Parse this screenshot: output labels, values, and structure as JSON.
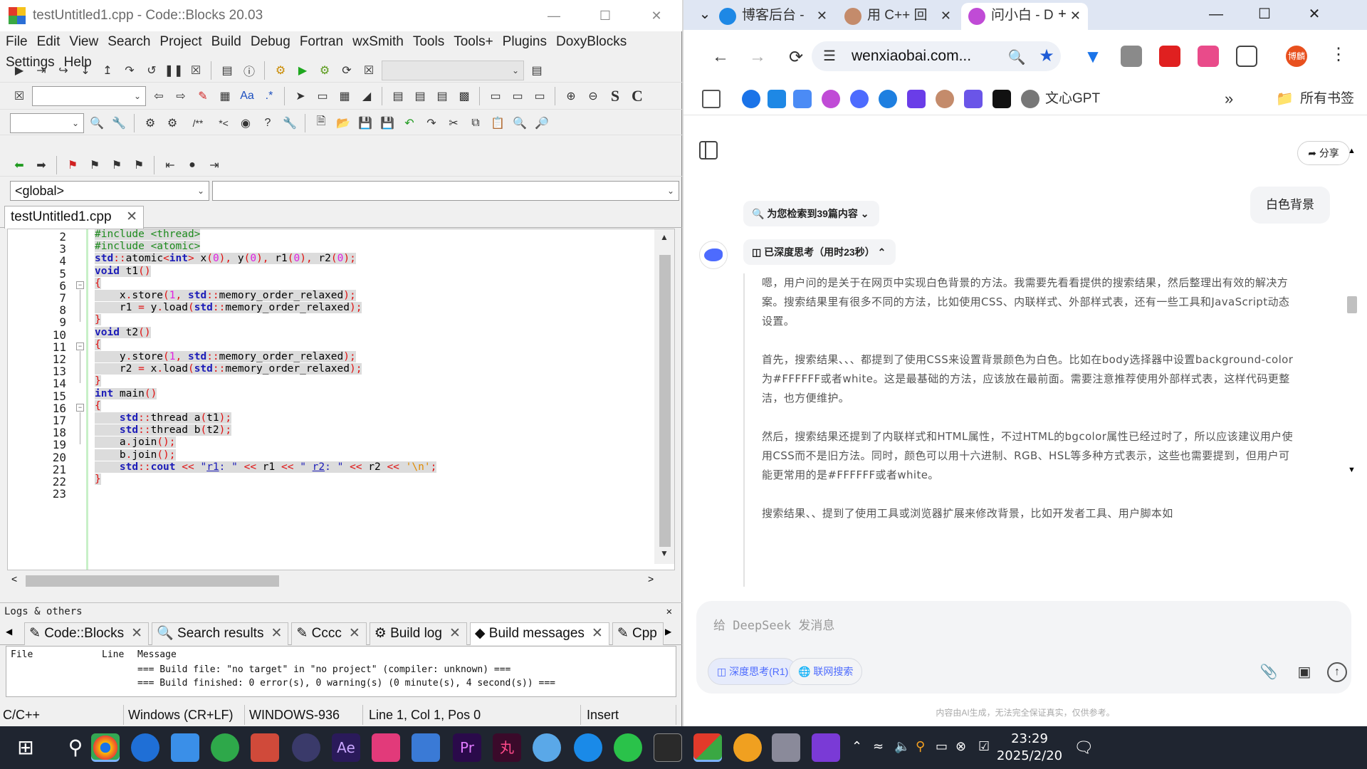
{
  "codeblocks": {
    "title": "testUntitled1.cpp - Code::Blocks 20.03",
    "menu": [
      "File",
      "Edit",
      "View",
      "Search",
      "Project",
      "Build",
      "Debug",
      "Fortran",
      "wxSmith",
      "Tools",
      "Tools+",
      "Plugins",
      "DoxyBlocks",
      "Settings",
      "Help"
    ],
    "scope_combo": "<global>",
    "editor_tab": "testUntitled1.cpp",
    "code_lines": [
      {
        "n": "2",
        "html": "<span class='sel'><span class='pp'>#include &lt;thread&gt;</span></span>"
      },
      {
        "n": "3",
        "html": "<span class='sel'><span class='pp'>#include &lt;atomic&gt;</span></span>"
      },
      {
        "n": "4",
        "html": "<span class='sel'><span class='ns'>std</span><span class='op'>::</span>atomic<span class='op'>&lt;</span><span class='k'>int</span><span class='op'>&gt;</span> x<span class='op'>(</span><span class='num'>0</span><span class='op'>),</span> y<span class='op'>(</span><span class='num'>0</span><span class='op'>),</span> r1<span class='op'>(</span><span class='num'>0</span><span class='op'>),</span> r2<span class='op'>(</span><span class='num'>0</span><span class='op'>);</span></span>"
      },
      {
        "n": "5",
        "html": "<span class='sel'><span class='k'>void</span> t1<span class='op'>()</span></span>"
      },
      {
        "n": "6",
        "html": "<span class='sel'><span class='op'>{</span></span>"
      },
      {
        "n": "7",
        "html": "<span class='sel'>    x<span class='op'>.</span>store<span class='op'>(</span><span class='num'>1</span><span class='op'>,</span> <span class='ns'>std</span><span class='op'>::</span>memory_order_relaxed<span class='op'>);</span></span>"
      },
      {
        "n": "8",
        "html": "<span class='sel'>    r1 <span class='op'>=</span> y<span class='op'>.</span>load<span class='op'>(</span><span class='ns'>std</span><span class='op'>::</span>memory_order_relaxed<span class='op'>);</span></span>"
      },
      {
        "n": "9",
        "html": "<span class='sel'><span class='op'>}</span></span>"
      },
      {
        "n": "10",
        "html": "<span class='sel'><span class='k'>void</span> t2<span class='op'>()</span></span>"
      },
      {
        "n": "11",
        "html": "<span class='sel'><span class='op'>{</span></span>"
      },
      {
        "n": "12",
        "html": "<span class='sel'>    y<span class='op'>.</span>store<span class='op'>(</span><span class='num'>1</span><span class='op'>,</span> <span class='ns'>std</span><span class='op'>::</span>memory_order_relaxed<span class='op'>);</span></span>"
      },
      {
        "n": "13",
        "html": "<span class='sel'>    r2 <span class='op'>=</span> x<span class='op'>.</span>load<span class='op'>(</span><span class='ns'>std</span><span class='op'>::</span>memory_order_relaxed<span class='op'>);</span></span>"
      },
      {
        "n": "14",
        "html": "<span class='sel'><span class='op'>}</span></span>"
      },
      {
        "n": "15",
        "html": "<span class='sel'><span class='k'>int</span> main<span class='op'>()</span></span>"
      },
      {
        "n": "16",
        "html": "<span class='sel'><span class='op'>{</span></span>"
      },
      {
        "n": "17",
        "html": "<span class='sel'>    <span class='ns'>std</span><span class='op'>::</span>thread a<span class='op'>(</span>t1<span class='op'>);</span></span>"
      },
      {
        "n": "18",
        "html": "<span class='sel'>    <span class='ns'>std</span><span class='op'>::</span>thread b<span class='op'>(</span>t2<span class='op'>);</span></span>"
      },
      {
        "n": "19",
        "html": "<span class='sel'>    a<span class='op'>.</span>join<span class='op'>();</span></span>"
      },
      {
        "n": "20",
        "html": "<span class='sel'>    b<span class='op'>.</span>join<span class='op'>();</span></span>"
      },
      {
        "n": "21",
        "html": "<span class='sel'>    <span class='ns'>std</span><span class='op'>::</span><span class='ns'>cout</span> <span class='op'>&lt;&lt;</span> <span class='str'>\"<u>r1</u>: \"</span> <span class='op'>&lt;&lt;</span> r1 <span class='op'>&lt;&lt;</span> <span class='str'>\" <u>r2</u>: \"</span> <span class='op'>&lt;&lt;</span> r2 <span class='op'>&lt;&lt;</span> <span class='chr'>'\\n'</span><span class='op'>;</span></span>"
      },
      {
        "n": "22",
        "html": "<span class='sel'><span class='op'>}</span></span>"
      },
      {
        "n": "23",
        "html": ""
      }
    ],
    "logs_header": "Logs & others",
    "log_tabs": [
      "Code::Blocks",
      "Search results",
      "Cccc",
      "Build log",
      "Build messages",
      "Cpp"
    ],
    "log_columns": [
      "File",
      "Line",
      "Message"
    ],
    "log_rows": [
      "=== Build file: \"no target\" in \"no project\" (compiler: unknown) ===",
      "=== Build finished: 0 error(s), 0 warning(s) (0 minute(s), 4 second(s)) ==="
    ],
    "status": [
      "C/C++",
      "Windows (CR+LF)",
      "WINDOWS-936",
      "Line 1, Col 1, Pos 0",
      "Insert"
    ]
  },
  "chrome": {
    "tabs": [
      {
        "title": "博客后台 -",
        "color": "#1e88e5"
      },
      {
        "title": "用 C++ 回",
        "color": "#c48b6b"
      },
      {
        "title": "问小白 - D",
        "color": "#c04bd6"
      }
    ],
    "url": "wenxiaobai.com...",
    "bookmark_label": "文心GPT",
    "all_bookmarks": "所有书签",
    "profile_badge": "博麟",
    "share_label": "分享",
    "user_message": "白色背景",
    "search_pill": "为您检索到39篇内容",
    "think_pill": "已深度思考（用时23秒）",
    "think_paragraphs": [
      "嗯，用户问的是关于在网页中实现白色背景的方法。我需要先看看提供的搜索结果，然后整理出有效的解决方案。搜索结果里有很多不同的方法，比如使用CSS、内联样式、外部样式表，还有一些工具和JavaScript动态设置。",
      "首先，搜索结果、、、都提到了使用CSS来设置背景颜色为白色。比如在body选择器中设置background-color为#FFFFFF或者white。这是最基础的方法，应该放在最前面。需要注意推荐使用外部样式表，这样代码更整洁，也方便维护。",
      "然后，搜索结果还提到了内联样式和HTML属性，不过HTML的bgcolor属性已经过时了，所以应该建议用户使用CSS而不是旧方法。同时，颜色可以用十六进制、RGB、HSL等多种方式表示，这些也需要提到，但用户可能更常用的是#FFFFFF或者white。",
      "搜索结果、、提到了使用工具或浏览器扩展来修改背景，比如开发者工具、用户脚本如"
    ],
    "composer_placeholder": "给 DeepSeek 发消息",
    "deep_think_btn": "深度思考(R1)",
    "web_search_btn": "联网搜索",
    "disclaimer": "内容由AI生成，无法完全保证真实，仅供参考。"
  },
  "taskbar": {
    "time": "23:29",
    "date": "2025/2/20"
  }
}
